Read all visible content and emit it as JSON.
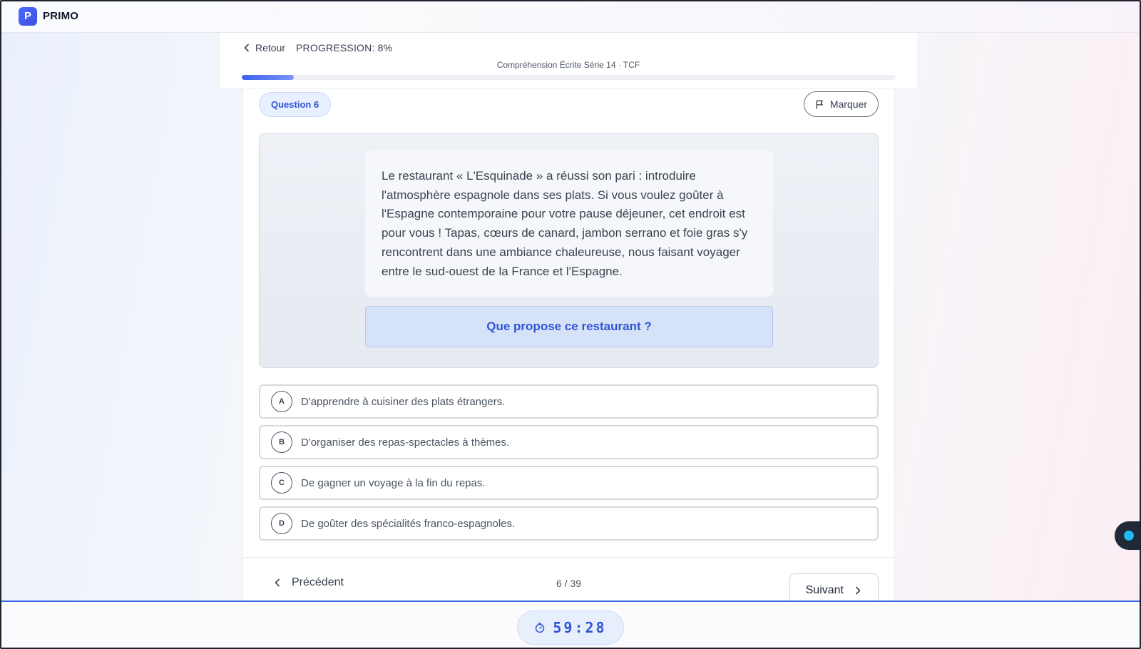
{
  "app": {
    "logo_letter": "P",
    "brand": "PRIMO"
  },
  "header": {
    "back_label": "Retour",
    "progress_label": "PROGRESSION: 8%",
    "progress_value": 0.08,
    "series_title": "Compréhension Écrite Série 14 · TCF"
  },
  "question": {
    "badge": "Question 6",
    "mark_label": "Marquer",
    "passage": "Le restaurant « L'Esquinade » a réussi son pari : introduire l'atmosphère espagnole dans ses plats. Si vous voulez goûter à l'Espagne contemporaine pour votre pause déjeuner, cet endroit est pour vous ! Tapas, cœurs de canard, jambon serrano et foie gras s'y rencontrent dans une ambiance chaleureuse, nous faisant voyager entre le sud-ouest de la France et l'Espagne.",
    "prompt": "Que propose ce restaurant ?",
    "options": [
      {
        "letter": "A",
        "text": "D'apprendre à cuisiner des plats étrangers."
      },
      {
        "letter": "B",
        "text": "D'organiser des repas-spectacles à thèmes."
      },
      {
        "letter": "C",
        "text": "De gagner un voyage à la fin du repas."
      },
      {
        "letter": "D",
        "text": "De goûter des spécialités franco-espagnoles."
      }
    ]
  },
  "navigation": {
    "prev_label": "Précédent",
    "counter": "6 / 39",
    "next_label": "Suivant"
  },
  "timer": {
    "value": "59:28"
  },
  "icons": {
    "back": "chevron-left-icon",
    "flag": "flag-icon",
    "prev": "chevron-left-icon",
    "next": "chevron-right-icon",
    "timer": "stopwatch-icon"
  },
  "colors": {
    "accent": "#2f55d4",
    "progress_fill": "#3b63f0",
    "widget_dot": "#22b8f0"
  }
}
